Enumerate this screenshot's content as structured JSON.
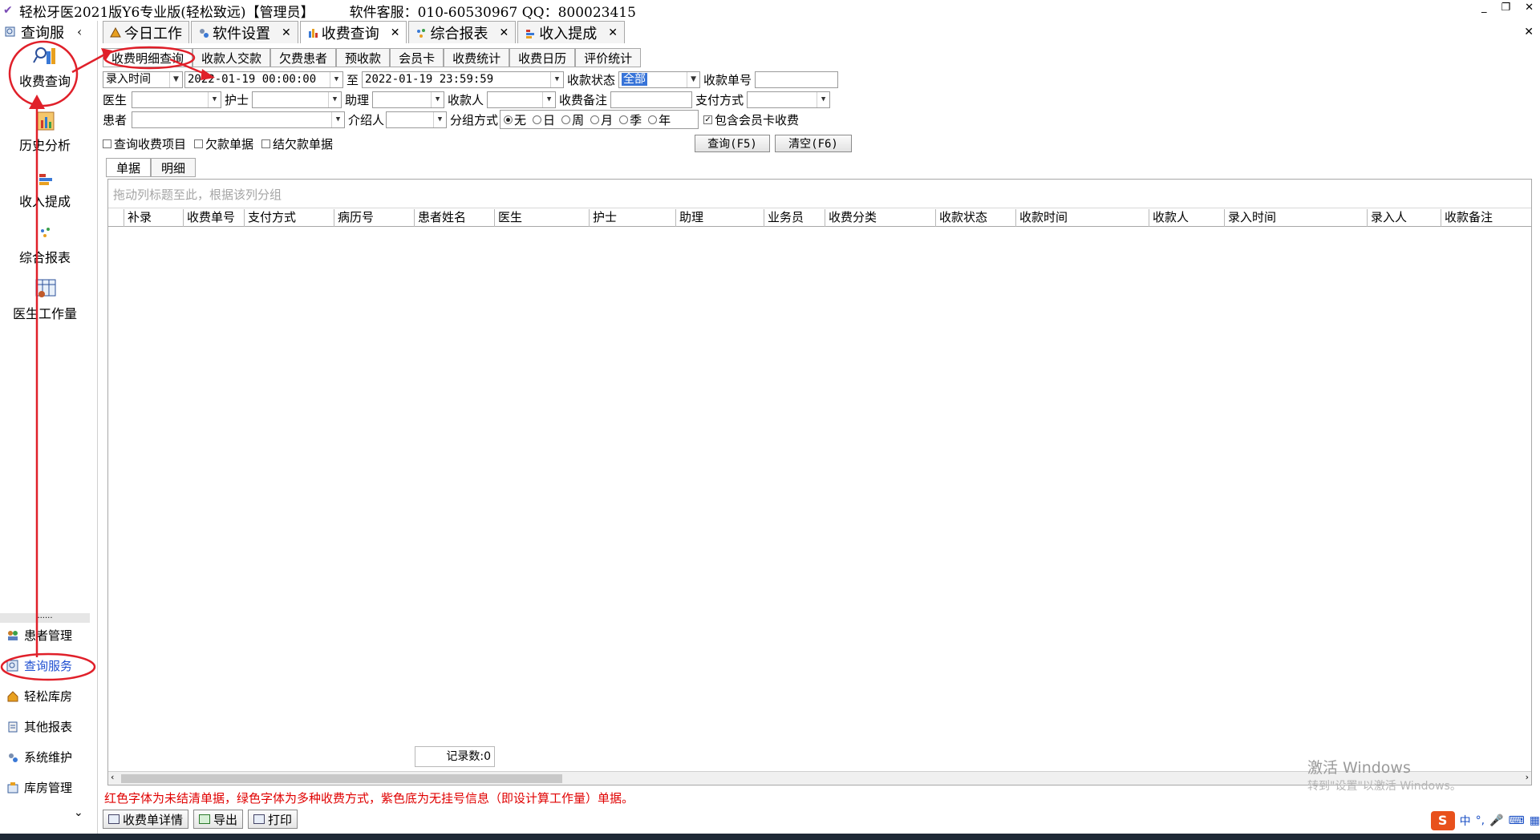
{
  "window": {
    "title": "轻松牙医2021版Y6专业版(轻松致远)【管理员】",
    "contact": "软件客服：010-60530967  QQ：800023415",
    "min_icon": "minimize-icon",
    "restore_icon": "restore-icon",
    "close_icon": "close-icon"
  },
  "sidebar": {
    "header": "查询服",
    "items": [
      {
        "label": "收费查询",
        "icon": "charge-query-icon"
      },
      {
        "label": "历史分析",
        "icon": "history-analysis-icon"
      },
      {
        "label": "收入提成",
        "icon": "income-commission-icon"
      },
      {
        "label": "综合报表",
        "icon": "report-icon"
      },
      {
        "label": "医生工作量",
        "icon": "doctor-workload-icon"
      }
    ],
    "dots": "......",
    "nav": [
      {
        "label": "患者管理",
        "icon": "patients-icon"
      },
      {
        "label": "查询服务",
        "icon": "query-service-icon"
      },
      {
        "label": "轻松库房",
        "icon": "warehouse-icon"
      },
      {
        "label": "其他报表",
        "icon": "other-reports-icon"
      },
      {
        "label": "系统维护",
        "icon": "system-maintenance-icon"
      },
      {
        "label": "库房管理",
        "icon": "warehouse-manage-icon"
      }
    ]
  },
  "main_tabs": [
    {
      "label": "今日工作"
    },
    {
      "label": "软件设置"
    },
    {
      "label": "收费查询"
    },
    {
      "label": "综合报表"
    },
    {
      "label": "收入提成"
    }
  ],
  "sub_tabs": [
    "收费明细查询",
    "收款人交款",
    "欠费患者",
    "预收款",
    "会员卡",
    "收费统计",
    "收费日历",
    "评价统计"
  ],
  "filters": {
    "time_type": "录入时间",
    "start_time": "2022-01-19 00:00:00",
    "to_label": "至",
    "end_time": "2022-01-19 23:59:59",
    "status_label": "收款状态",
    "status_value": "全部",
    "receipt_no_label": "收款单号",
    "doctor_label": "医生",
    "nurse_label": "护士",
    "assistant_label": "助理",
    "payee_label": "收款人",
    "remark_label": "收费备注",
    "pay_method_label": "支付方式",
    "patient_label": "患者",
    "referrer_label": "介绍人",
    "group_label": "分组方式",
    "group_options": [
      "无",
      "日",
      "周",
      "月",
      "季",
      "年"
    ],
    "include_member_label": "包含会员卡收费",
    "query_items_label": "查询收费项目",
    "owed_label": "欠款单据",
    "settled_owed_label": "结欠款单据",
    "query_button": "查询(F5)",
    "clear_button": "清空(F6)"
  },
  "inner_tabs": [
    "单据",
    "明细"
  ],
  "grid": {
    "group_hint": "拖动列标题至此，根据该列分组",
    "columns": [
      "补录",
      "收费单号",
      "支付方式",
      "病历号",
      "患者姓名",
      "医生",
      "护士",
      "助理",
      "业务员",
      "收费分类",
      "收款状态",
      "收款时间",
      "收款人",
      "录入时间",
      "录入人",
      "收款备注"
    ],
    "record_count": "记录数:0"
  },
  "watermark": {
    "line1": "激活 Windows",
    "line2": "转到\"设置\"以激活 Windows。"
  },
  "status_note": "红色字体为未结清单据，绿色字体为多种收费方式，紫色底为无挂号信息（即设计算工作量）单据。",
  "bottom_buttons": [
    "收费单详情",
    "导出",
    "打印"
  ],
  "tray": {
    "ime": "中",
    "sogou": "S"
  },
  "colors": {
    "annotation": "#e0202a",
    "active_nav": "#1f4fd1",
    "note_red": "#e00000",
    "highlight": "#3874d8"
  }
}
